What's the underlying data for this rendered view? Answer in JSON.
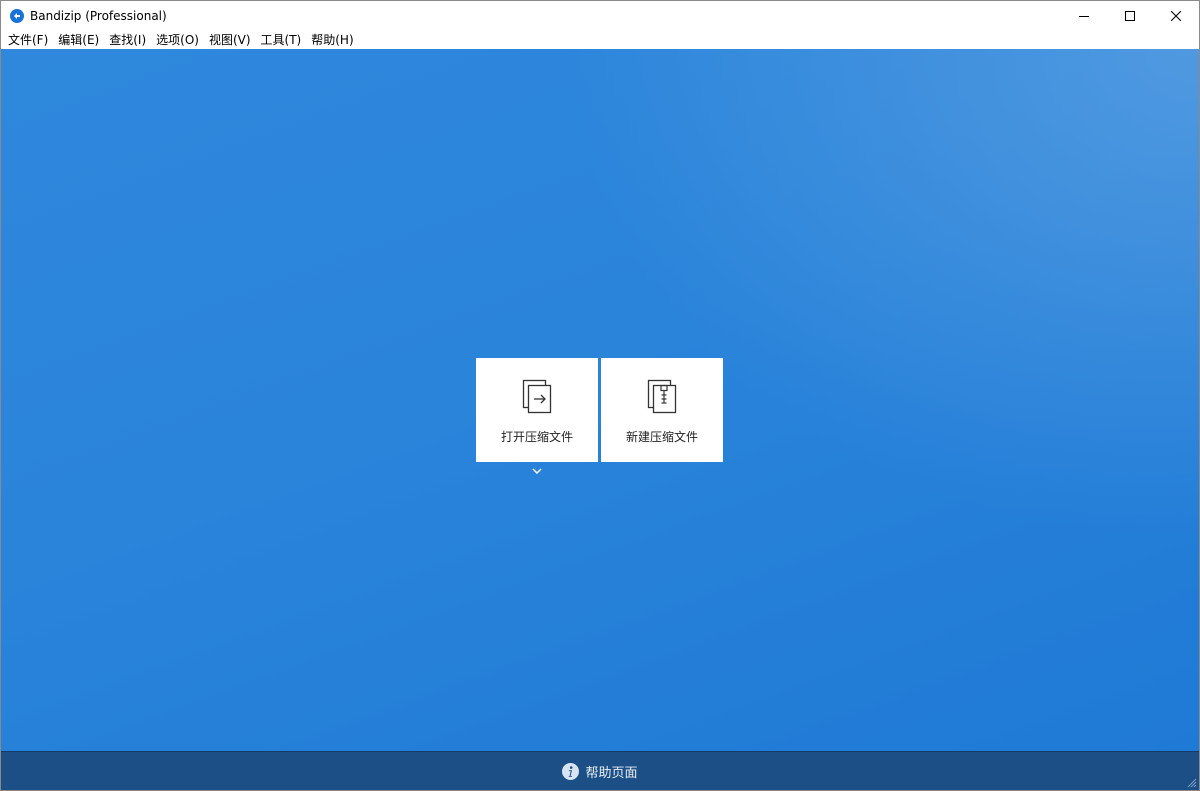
{
  "window": {
    "title": "Bandizip (Professional)",
    "controls": [
      "minimize",
      "maximize",
      "close"
    ]
  },
  "menu": {
    "items": [
      {
        "label": "文件(F)"
      },
      {
        "label": "编辑(E)"
      },
      {
        "label": "查找(I)"
      },
      {
        "label": "选项(O)"
      },
      {
        "label": "视图(V)"
      },
      {
        "label": "工具(T)"
      },
      {
        "label": "帮助(H)"
      }
    ]
  },
  "main": {
    "cards": [
      {
        "label": "打开压缩文件",
        "icon": "open-archive-icon"
      },
      {
        "label": "新建压缩文件",
        "icon": "new-archive-icon"
      }
    ]
  },
  "footer": {
    "help_label": "帮助页面",
    "icon": "info-icon"
  },
  "colors": {
    "main_background": "#2a84da",
    "footer_background": "#1b4f86",
    "app_icon": "#1a73d9"
  }
}
